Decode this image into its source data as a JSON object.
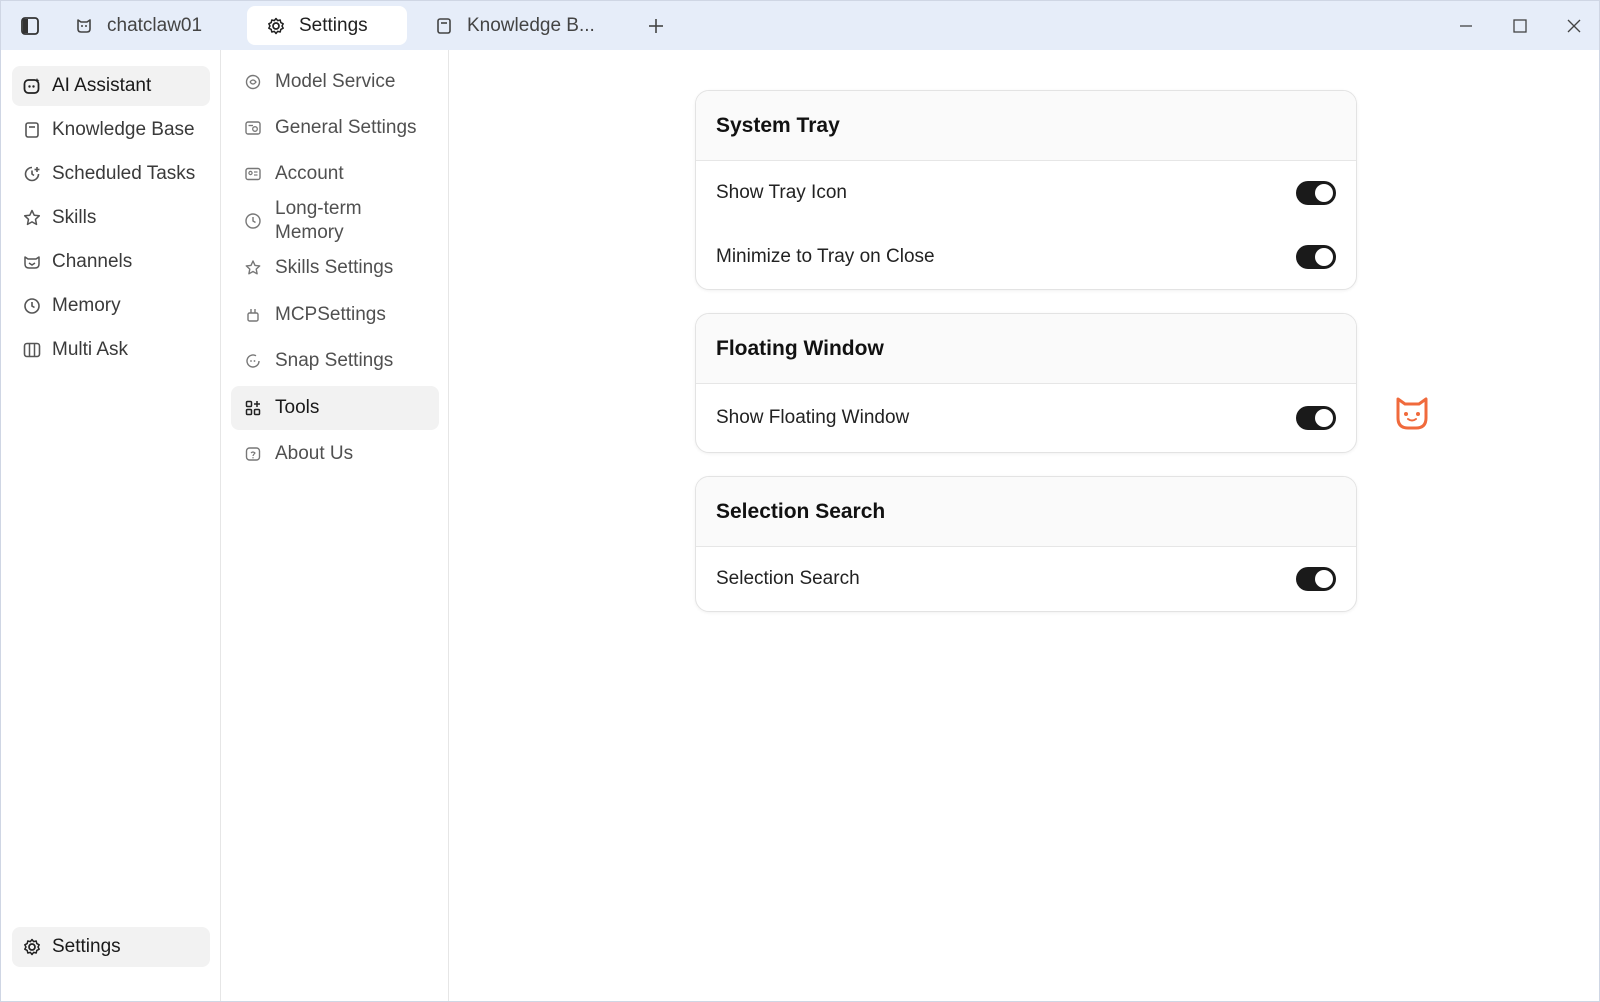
{
  "titlebar": {
    "tabs": [
      {
        "label": "chatclaw01",
        "icon": "cat-chat-icon"
      },
      {
        "label": "Settings",
        "icon": "gear-icon",
        "active": true
      },
      {
        "label": "Knowledge B...",
        "icon": "book-icon"
      }
    ],
    "new_tab": "+"
  },
  "leftnav": {
    "items": [
      {
        "label": "AI Assistant",
        "icon": "assistant-icon",
        "active": true
      },
      {
        "label": "Knowledge Base",
        "icon": "book-icon"
      },
      {
        "label": "Scheduled Tasks",
        "icon": "clock-plus-icon"
      },
      {
        "label": "Skills",
        "icon": "star-icon"
      },
      {
        "label": "Channels",
        "icon": "channels-icon"
      },
      {
        "label": "Memory",
        "icon": "clock-icon"
      },
      {
        "label": "Multi Ask",
        "icon": "columns-icon"
      }
    ],
    "footer": {
      "label": "Settings",
      "icon": "gear-icon"
    }
  },
  "settings_nav": {
    "items": [
      {
        "label": "Model Service",
        "icon": "model-icon"
      },
      {
        "label": "General Settings",
        "icon": "general-icon"
      },
      {
        "label": "Account",
        "icon": "account-card-icon"
      },
      {
        "label": "Long-term Memory",
        "icon": "clock-icon"
      },
      {
        "label": "Skills Settings",
        "icon": "star-icon"
      },
      {
        "label": "MCPSettings",
        "icon": "plug-icon"
      },
      {
        "label": "Snap Settings",
        "icon": "snap-icon"
      },
      {
        "label": "Tools",
        "icon": "tools-grid-icon",
        "active": true
      },
      {
        "label": "About Us",
        "icon": "about-icon"
      }
    ]
  },
  "cards": [
    {
      "title": "System Tray",
      "rows": [
        {
          "label": "Show Tray Icon",
          "enabled": true
        },
        {
          "label": "Minimize to Tray on Close",
          "enabled": true
        }
      ]
    },
    {
      "title": "Floating Window",
      "rows": [
        {
          "label": "Show Floating Window",
          "enabled": true
        }
      ]
    },
    {
      "title": "Selection Search",
      "rows": [
        {
          "label": "Selection Search",
          "enabled": true
        }
      ]
    }
  ],
  "colors": {
    "titlebar_bg": "#e6edf9",
    "toggle_on": "#1a1a1a",
    "mascot": "#f06a3c"
  }
}
